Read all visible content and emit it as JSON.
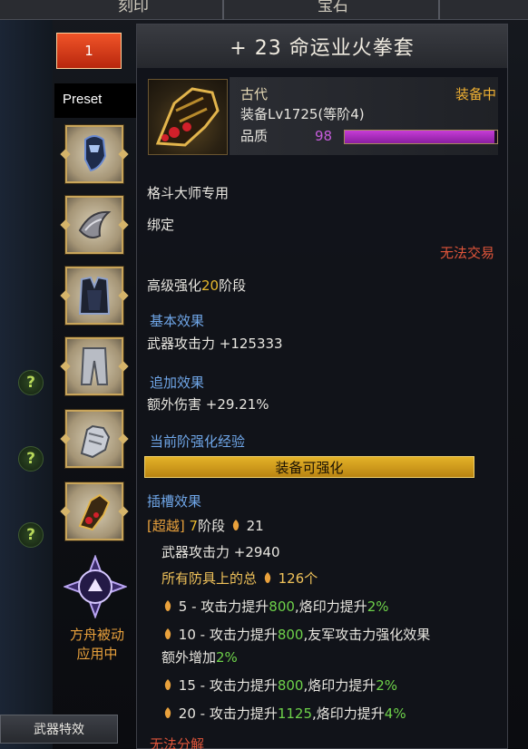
{
  "background": {
    "top_tabs": [
      "刻印",
      "宝石"
    ],
    "slot_tab_number": "1",
    "preset_label": "Preset",
    "help_marks": [
      "?",
      "?",
      "?"
    ],
    "ark_passive_line1": "方舟被动",
    "ark_passive_line2": "应用中",
    "weapon_effect_button": "武器特效",
    "equip_slots": [
      "head-icon",
      "shoulder-icon",
      "chest-icon",
      "pants-icon",
      "gloves-icon",
      "weapon-icon"
    ]
  },
  "tooltip": {
    "title": "+ 23 命运业火拳套",
    "rarity": "古代",
    "status": "装备中",
    "item_level": "装备Lv1725(等阶4)",
    "quality_label": "品质",
    "quality_value": "98",
    "quality_fraction": 0.98,
    "class_restriction": "格斗大师专用",
    "bound": "绑定",
    "trade_status": "无法交易",
    "advanced_honing": {
      "prefix": "高级强化",
      "value": "20",
      "suffix": "阶段"
    },
    "basic_effect": {
      "header": "基本效果",
      "line": "武器攻击力 +125333"
    },
    "additional_effect": {
      "header": "追加效果",
      "line": "额外伤害 +29.21%"
    },
    "honing_exp": {
      "header": "当前阶强化经验",
      "bar_label": "装备可强化"
    },
    "socket": {
      "header": "插槽效果",
      "transcend_tag": "[超越]",
      "transcend_stage": "7",
      "stage_label": "阶段",
      "flame_count": "21",
      "weapon_attack": "武器攻击力 +2940",
      "total_label": "所有防具上的总",
      "total_count": "126个",
      "bonuses": [
        {
          "threshold": "5",
          "text_a": " - 攻击力提升",
          "val_a": "800",
          "text_b": ",烙印力提升",
          "val_b": "2%"
        },
        {
          "threshold": "10",
          "text_a": " - 攻击力提升",
          "val_a": "800",
          "text_b": ",友军攻击力强化效果",
          "line2_a": "额外增加",
          "line2_val": "2%"
        },
        {
          "threshold": "15",
          "text_a": " - 攻击力提升",
          "val_a": "800",
          "text_b": ",烙印力提升",
          "val_b": "2%"
        },
        {
          "threshold": "20",
          "text_a": " - 攻击力提升",
          "val_a": "1125",
          "text_b": ",烙印力提升",
          "val_b": "4%"
        }
      ]
    },
    "disassemble": "无法分解"
  },
  "colors": {
    "accent_gold": "#e6b82e",
    "quality_purple": "#c63cd6",
    "header_blue": "#6fa6e8",
    "warning_red": "#e0553a",
    "bonus_green": "#6ed24a"
  }
}
